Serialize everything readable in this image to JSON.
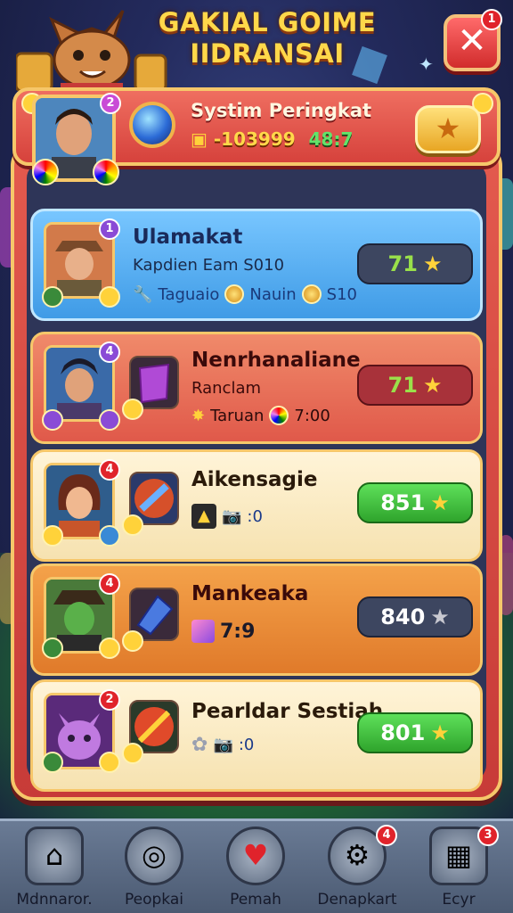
{
  "header": {
    "title_line1": "GAKIAL GOIME",
    "title_line2": "IIDRANSAI",
    "close_badge": "1"
  },
  "rank_panel": {
    "title": "Systim Peringkat",
    "coins": "-103999",
    "ratio": "48:7",
    "avatar_badge": "2"
  },
  "cards": [
    {
      "name": "Ulamakat",
      "sub": "Kapdien Eam S010",
      "meta": [
        "Taguaio",
        "Nauin",
        "S10"
      ],
      "score": "71",
      "badge": "1",
      "theme": "blue"
    },
    {
      "name": "Nenrhanaliane",
      "sub": "Ranclam",
      "meta": [
        "Taruan",
        "7:00"
      ],
      "score": "71",
      "badge": "4",
      "theme": "red"
    },
    {
      "name": "Aikensagie",
      "sub": "",
      "meta": [
        ":0"
      ],
      "score": "851",
      "badge": "4",
      "theme": "cream"
    },
    {
      "name": "Mankeaka",
      "sub": "",
      "meta": [
        "7:9"
      ],
      "score": "840",
      "badge": "4",
      "theme": "orange"
    },
    {
      "name": "Pearldar Sestiah",
      "sub": "",
      "meta": [
        ":0"
      ],
      "score": "801",
      "badge": "2",
      "theme": "cream"
    }
  ],
  "nav": [
    {
      "label": "Mdnnaror.",
      "icon": "home-star-icon",
      "badge": ""
    },
    {
      "label": "Peopkai",
      "icon": "target-icon",
      "badge": ""
    },
    {
      "label": "Pemah",
      "icon": "heart-icon",
      "badge": ""
    },
    {
      "label": "Denapkart",
      "icon": "gear-icon",
      "badge": "4"
    },
    {
      "label": "Ecyr",
      "icon": "grid-icon",
      "badge": "3"
    }
  ],
  "colors": {
    "frame": "#d6423c",
    "gold": "#f6c76a",
    "pill_green": "#3fbf3a",
    "pill_dark": "#3d4660"
  }
}
